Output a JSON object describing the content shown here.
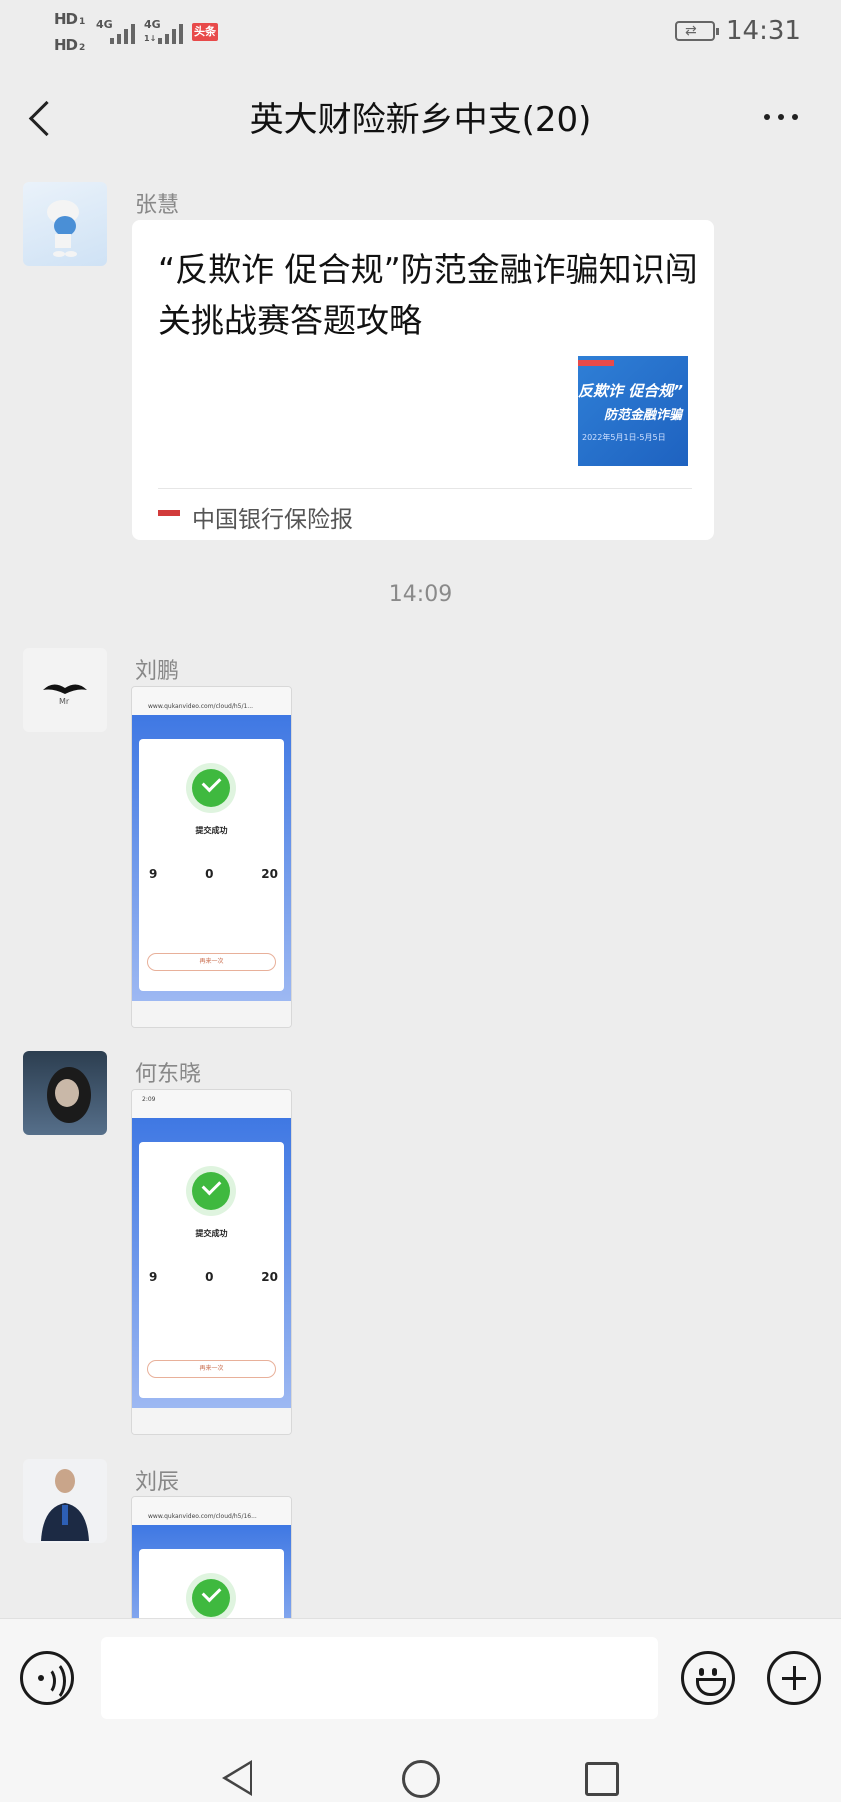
{
  "status_bar": {
    "hd1": "HD",
    "hd1_sub": "1",
    "hd2": "HD",
    "hd2_sub": "2",
    "net1": "4G",
    "net2": "4G",
    "net2_sub": "1↓",
    "app_badge": "头条",
    "time": "14:31"
  },
  "header": {
    "back_icon": "chevron-left-icon",
    "title": "英大财险新乡中支(20)",
    "more_icon": "more-dots-icon"
  },
  "messages": [
    {
      "sender": "张慧",
      "type": "link-card",
      "title": "“反欺诈 促合规”防范金融诈骗知识闯关挑战赛答题攻略",
      "thumb_top": "反欺诈 促合规”",
      "thumb_sub": "防范金融诈骗",
      "thumb_date": "2022年5月1日-5月5日",
      "source": "中国银行保险报"
    },
    {
      "timestamp": "14:09"
    },
    {
      "sender": "刘鹏",
      "type": "image",
      "shot": {
        "url": "www.qukanvideo.com/cloud/h5/1...",
        "status": "提交成功",
        "n1": "9",
        "n2": "0",
        "n3": "20",
        "button": "再来一次"
      }
    },
    {
      "sender": "何东晓",
      "type": "image",
      "shot": {
        "url": "2:09",
        "status": "提交成功",
        "n1": "9",
        "n2": "0",
        "n3": "20",
        "button": "再来一次"
      }
    },
    {
      "sender": "刘辰",
      "type": "image",
      "shot": {
        "url": "www.qukanvideo.com/cloud/h5/16..."
      }
    }
  ],
  "input_bar": {
    "voice_icon": "voice-icon",
    "emoji_icon": "emoji-icon",
    "plus_icon": "plus-icon",
    "text": ""
  },
  "colors": {
    "background": "#ededed",
    "card": "#ffffff",
    "check": "#3fb93f",
    "accent_blue": "#3f78e3"
  }
}
